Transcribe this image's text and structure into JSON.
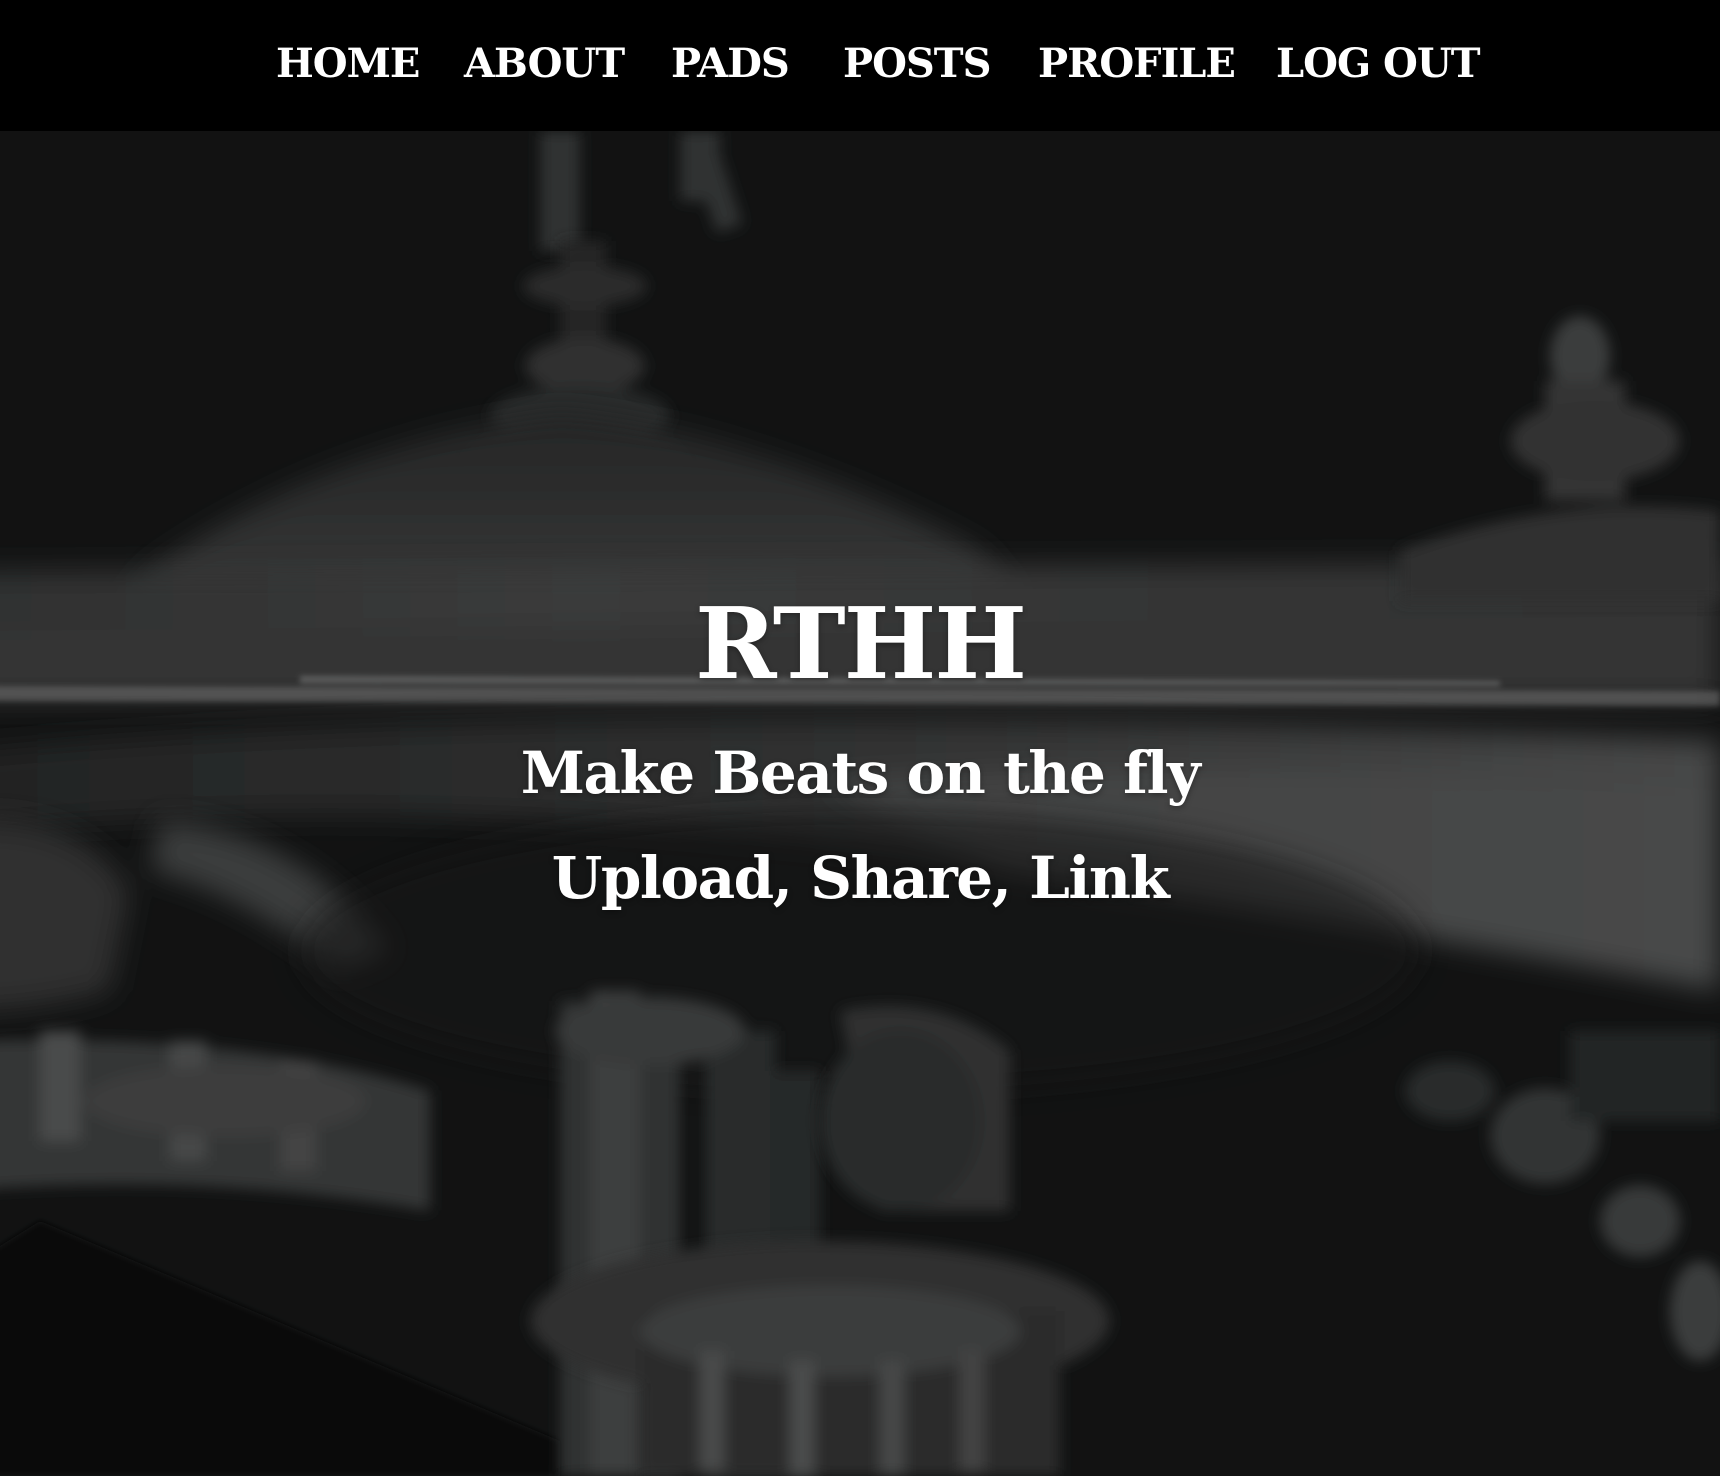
{
  "nav": {
    "items": [
      {
        "label": "HOME"
      },
      {
        "label": "ABOUT"
      },
      {
        "label": "PADS"
      },
      {
        "label": "POSTS"
      },
      {
        "label": "PROFILE"
      },
      {
        "label": "LOG OUT"
      }
    ]
  },
  "hero": {
    "title": "RTHH",
    "tagline": "Make Beats on the fly",
    "subtagline": "Upload, Share, Link",
    "background_image": "drum-kit-photo"
  },
  "colors": {
    "navbar_bg": "#000000",
    "hero_bg": "#171818",
    "text": "#ffffff"
  }
}
